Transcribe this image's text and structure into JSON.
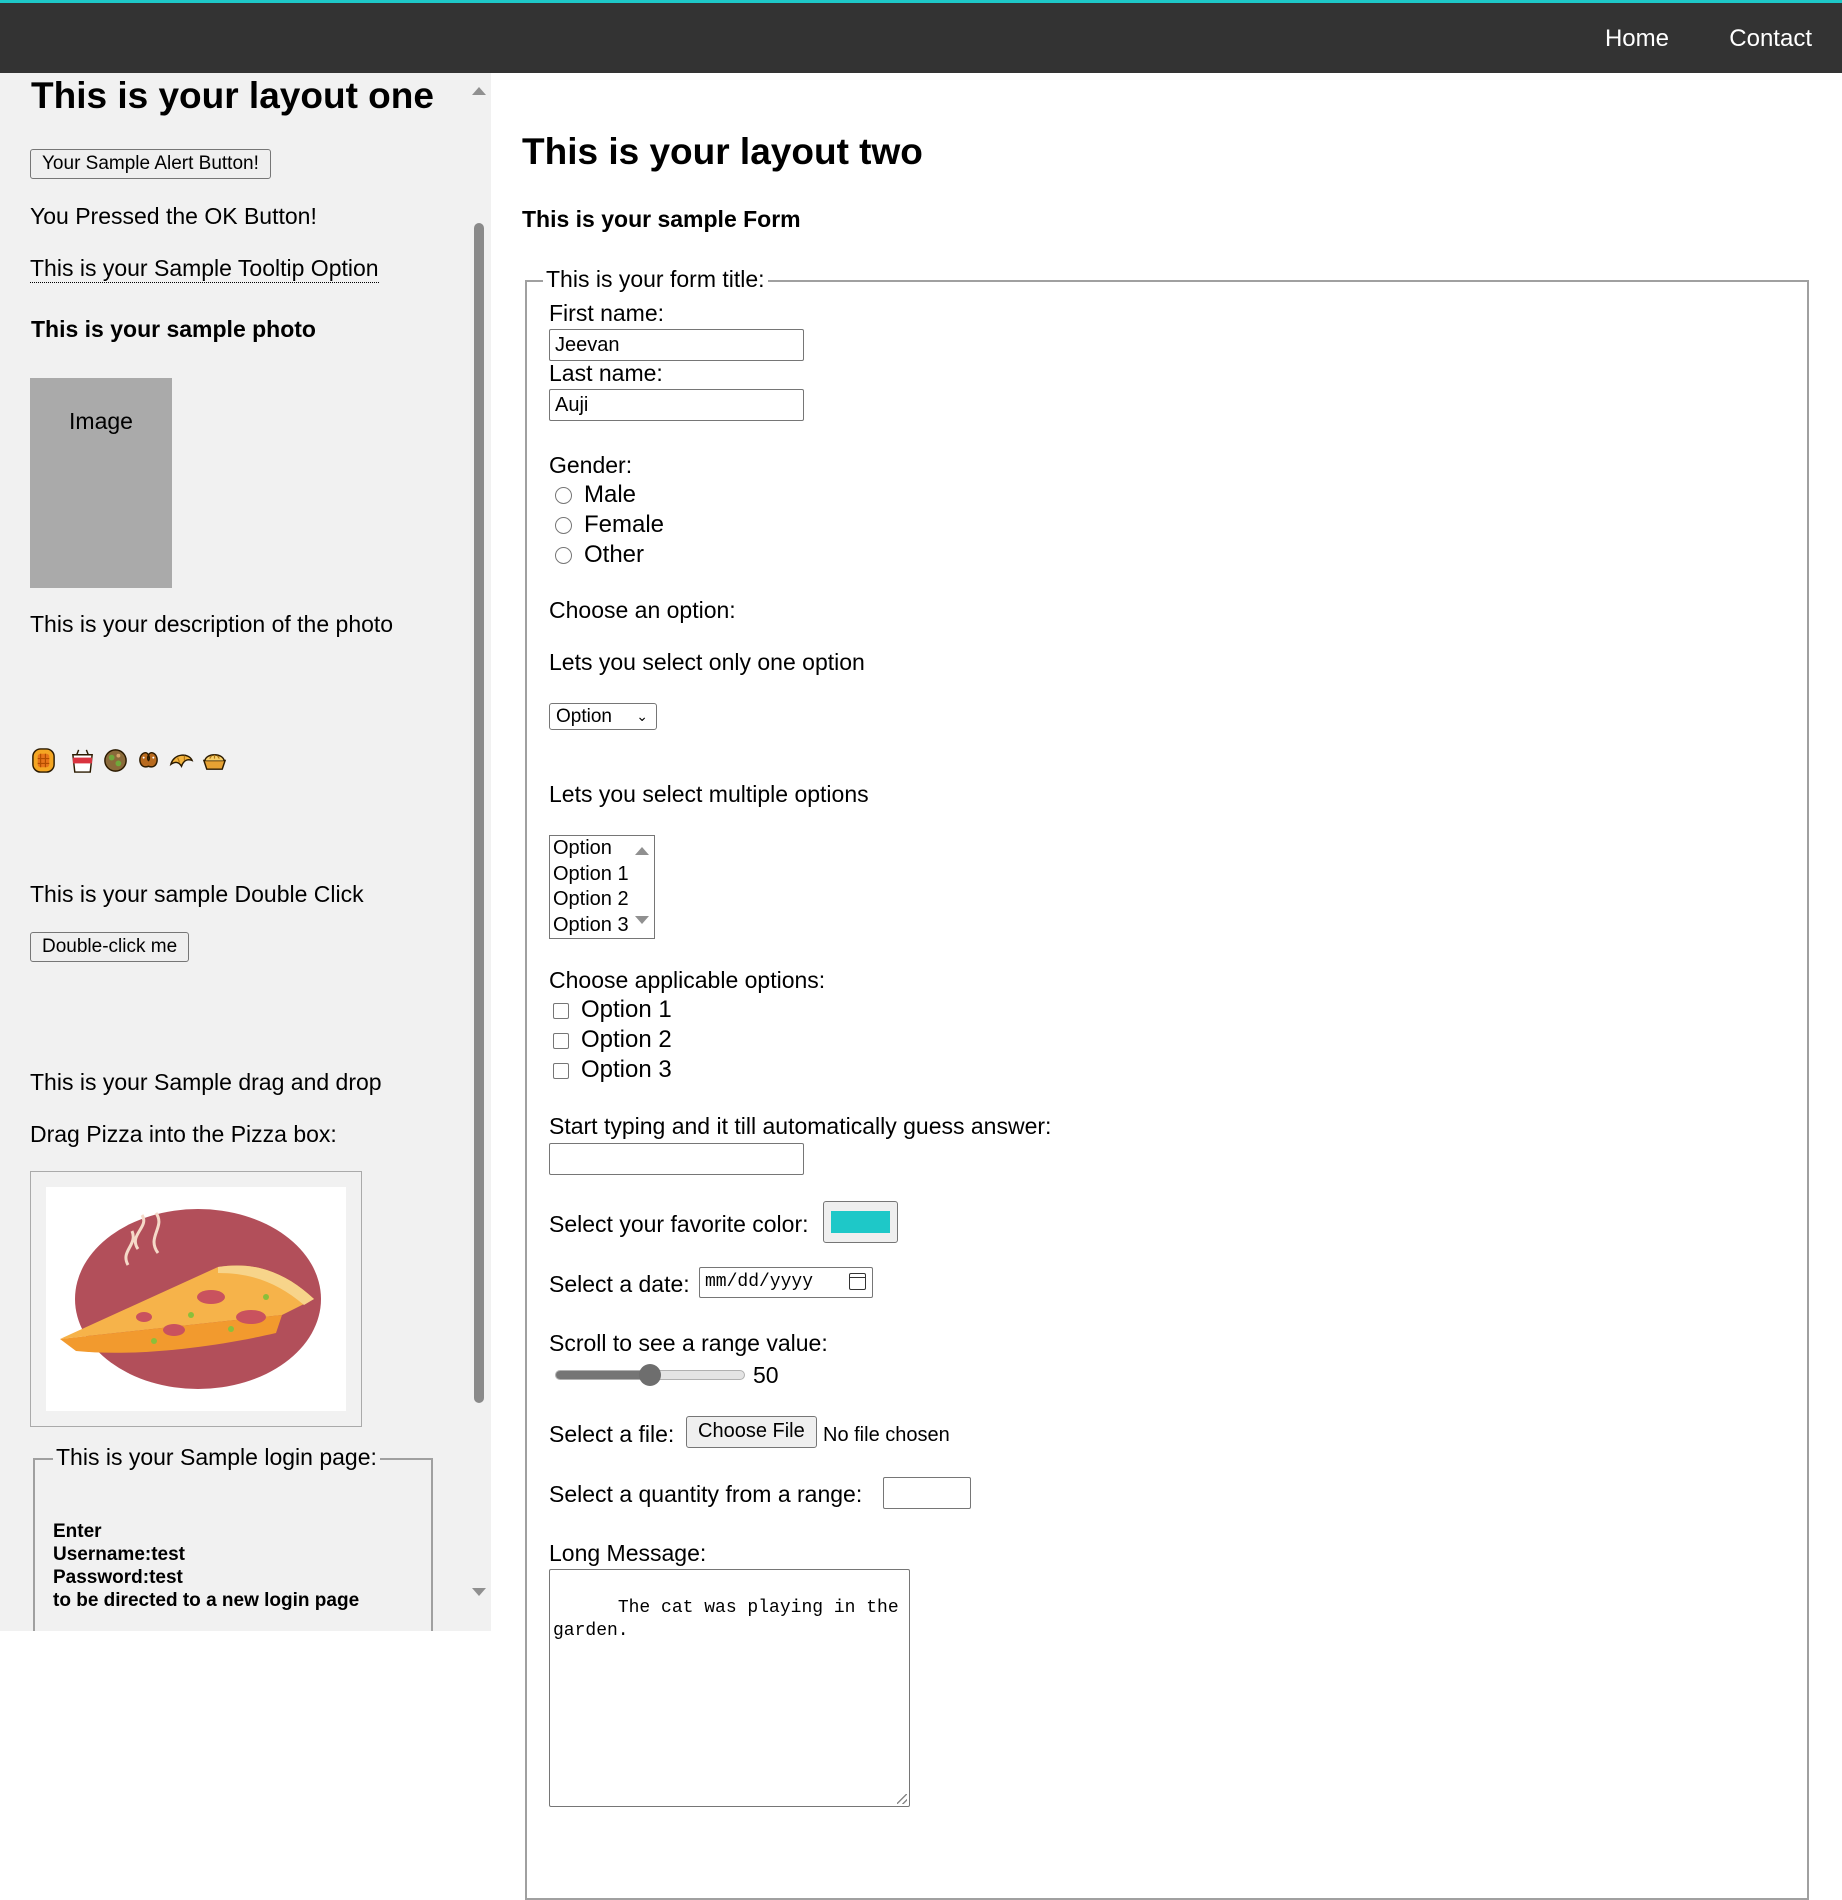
{
  "nav": {
    "home": "Home",
    "contact": "Contact"
  },
  "colors": {
    "accent": "#1ec8c8",
    "navbar": "#333333",
    "left_bg": "#f1f1f1",
    "color_value": "#1ec8c8"
  },
  "left": {
    "title": "This is your layout one",
    "alert_button": "Your Sample Alert Button!",
    "alert_result": "You Pressed the OK Button!",
    "tooltip_text": "This is your Sample Tooltip Option",
    "photo_heading": "This is your sample photo",
    "image_alt": "Image",
    "photo_description": "This is your description of the photo",
    "emoji_icons": [
      "waffle-icon",
      "takeout-box-icon",
      "falafel-icon",
      "pretzel-icon",
      "croissant-icon",
      "pie-icon"
    ],
    "double_click_label": "This is your sample Double Click",
    "double_click_button": "Double-click me",
    "drag_drop_label": "This is your Sample drag and drop",
    "drag_instruction": "Drag Pizza into the Pizza box:",
    "login_legend": "This is your Sample login page:",
    "login_lines": [
      "Enter",
      "Username:test",
      "Password:test",
      "to be directed to a new login page"
    ]
  },
  "right": {
    "title": "This is your layout two",
    "form_heading": "This is your sample Form",
    "form_legend": "This is your form title:",
    "first_name_label": "First name:",
    "first_name_value": "Jeevan",
    "last_name_label": "Last name:",
    "last_name_value": "Auji",
    "gender_label": "Gender:",
    "gender_options": [
      "Male",
      "Female",
      "Other"
    ],
    "choose_option_label": "Choose an option:",
    "single_select_label": "Lets you select only one option",
    "single_select_value": "Option",
    "multi_select_label": "Lets you select multiple options",
    "multi_select_options": [
      "Option",
      "Option 1",
      "Option 2",
      "Option 3"
    ],
    "checkbox_label": "Choose applicable options:",
    "checkbox_options": [
      "Option 1",
      "Option 2",
      "Option 3"
    ],
    "autocomplete_label": "Start typing and it till automatically guess answer:",
    "autocomplete_value": "",
    "color_label": "Select your favorite color:",
    "date_label": "Select a date:",
    "date_placeholder": "mm/dd/yyyy",
    "range_label": "Scroll to see a range value:",
    "range_value": "50",
    "range_fraction": 0.5,
    "file_label": "Select a file:",
    "file_button": "Choose File",
    "file_status": "No file chosen",
    "quantity_label": "Select a quantity from a range:",
    "quantity_value": "",
    "message_label": "Long Message:",
    "message_value": "The cat was playing in the\ngarden."
  }
}
